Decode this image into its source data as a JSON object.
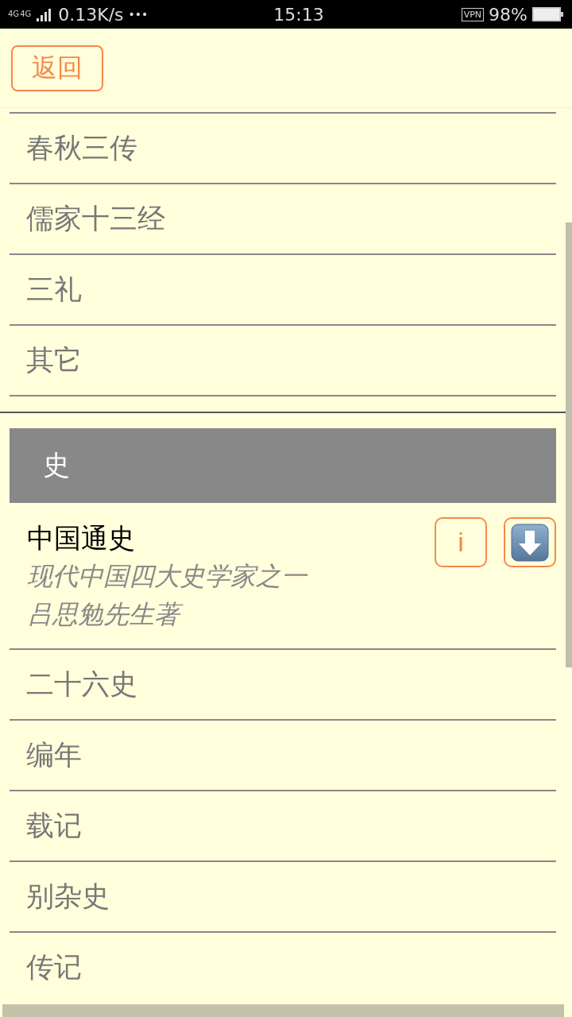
{
  "status_bar": {
    "network": [
      "4G",
      "4G"
    ],
    "speed": "0.13K/s",
    "more": "•••",
    "time": "15:13",
    "vpn": "VPN",
    "battery": "98%"
  },
  "back_button": "返回",
  "sections": [
    {
      "items": [
        {
          "kind": "plain",
          "title": "春秋三传"
        },
        {
          "kind": "plain",
          "title": "儒家十三经"
        },
        {
          "kind": "plain",
          "title": "三礼"
        },
        {
          "kind": "plain",
          "title": "其它"
        }
      ]
    },
    {
      "title": "史",
      "items": [
        {
          "kind": "detail",
          "title": "中国通史",
          "description": [
            "现代中国四大史学家之一",
            "吕思勉先生著"
          ],
          "info_button": "i"
        },
        {
          "kind": "plain",
          "title": "二十六史"
        },
        {
          "kind": "plain",
          "title": "编年"
        },
        {
          "kind": "plain",
          "title": "载记"
        },
        {
          "kind": "plain",
          "title": "别杂史"
        },
        {
          "kind": "plain",
          "title": "传记"
        }
      ]
    }
  ]
}
